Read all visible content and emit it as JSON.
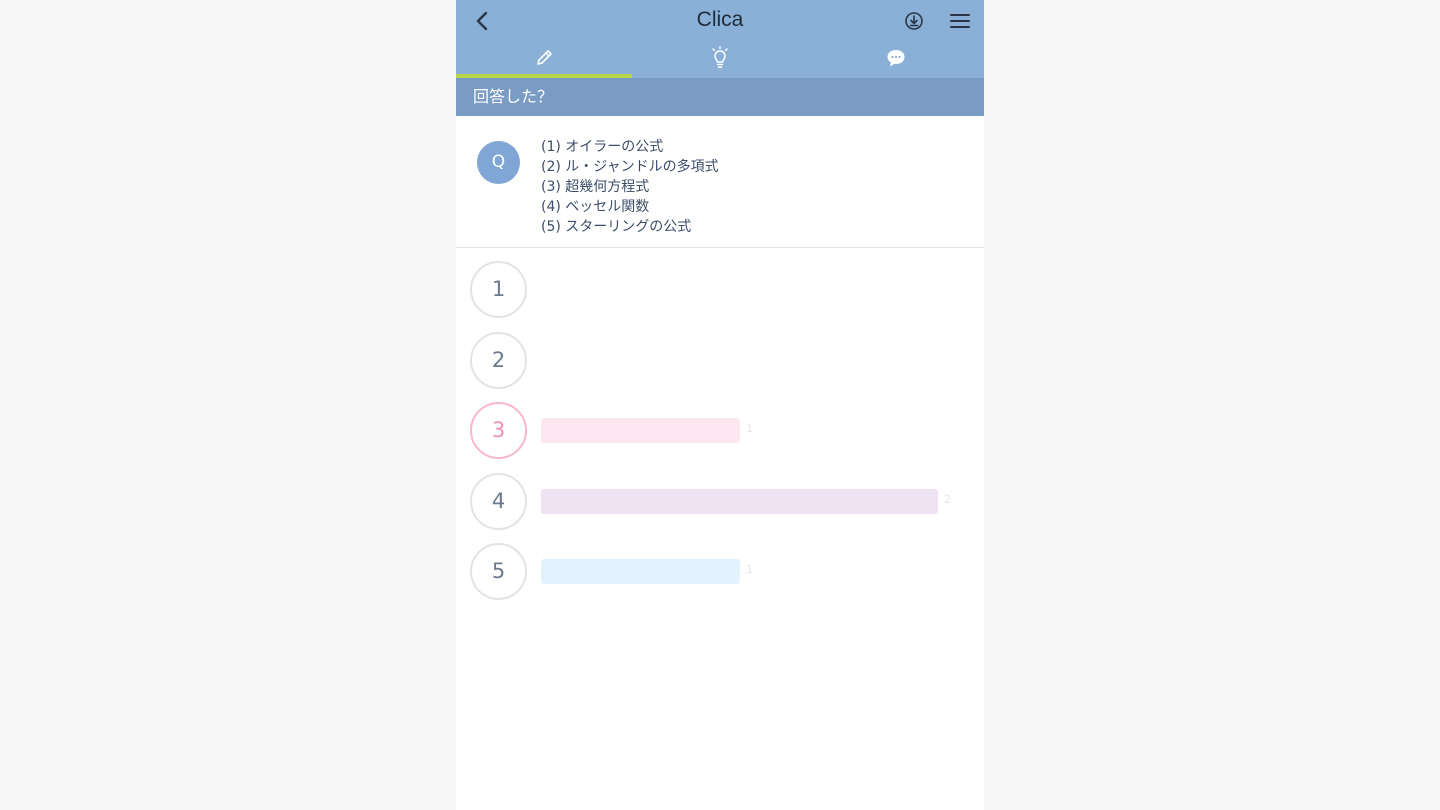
{
  "header": {
    "title": "Clica",
    "icons": {
      "back": "chevron-left-icon",
      "download": "download-icon",
      "menu": "hamburger-menu-icon"
    }
  },
  "tabs": [
    {
      "icon": "pencil-icon",
      "active": true
    },
    {
      "icon": "lightbulb-icon",
      "active": false
    },
    {
      "icon": "chat-bubble-icon",
      "active": false
    }
  ],
  "section": {
    "title": "回答した？"
  },
  "question": {
    "badge": "Q",
    "lines": [
      "(1) オイラーの公式",
      "(2) ル・ジャンドルの多項式",
      "(3) 超幾何方程式",
      "(4) ベッセル関数",
      "(5) スターリングの公式"
    ]
  },
  "options": [
    {
      "label": "1",
      "count": "",
      "selected": false
    },
    {
      "label": "2",
      "count": "",
      "selected": false
    },
    {
      "label": "3",
      "count": "1",
      "selected": true
    },
    {
      "label": "4",
      "count": "2",
      "selected": false
    },
    {
      "label": "5",
      "count": "1",
      "selected": false
    }
  ],
  "chart_data": {
    "type": "bar",
    "categories": [
      "1",
      "2",
      "3",
      "4",
      "5"
    ],
    "values": [
      0,
      0,
      1,
      2,
      1
    ],
    "colors": [
      "#fce6f0",
      "#fce6f0",
      "#fce6f0",
      "#efe2f3",
      "#e3f3fd"
    ]
  },
  "colors": {
    "header": "#8ab0d8",
    "section": "#7a9cc4",
    "tab_accent": "#b7d64a",
    "q_badge": "#7fa6d4",
    "selected": "#f48fb5"
  }
}
